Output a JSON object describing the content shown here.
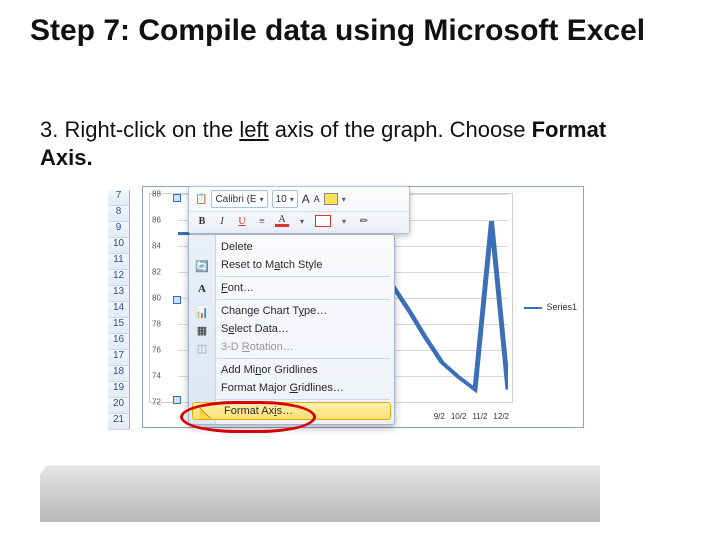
{
  "title": "Step 7: Compile data using Microsoft Excel",
  "instruction": {
    "prefix": "3. Right-click on the ",
    "underlined": "left",
    "middle": " axis of the graph. Choose ",
    "bold": "Format Axis."
  },
  "rows": [
    "7",
    "8",
    "9",
    "10",
    "11",
    "12",
    "13",
    "14",
    "15",
    "16",
    "17",
    "18",
    "19",
    "20",
    "21"
  ],
  "mini": {
    "font": "Calibri (E",
    "size": "10",
    "growLabel": "A",
    "shrinkLabel": "A",
    "b": "B",
    "i": "I",
    "u": "U",
    "a_color": "A"
  },
  "menu": {
    "delete": "Delete",
    "reset": {
      "pre": "Reset to M",
      "acc": "a",
      "post": "tch Style"
    },
    "font": {
      "acc": "F",
      "post": "ont…"
    },
    "changeType": {
      "pre": "Change Chart T",
      "acc": "y",
      "post": "pe…"
    },
    "selectData": {
      "pre": "S",
      "acc": "e",
      "post": "lect Data…"
    },
    "rotation": {
      "pre": "3-D ",
      "acc": "R",
      "post": "otation…"
    },
    "addMinor": {
      "pre": "Add Mi",
      "acc": "n",
      "post": "or Gridlines"
    },
    "formatMajor": {
      "pre": "Format Major ",
      "acc": "G",
      "post": "ridlines…"
    },
    "formatAxis": {
      "pre": "Format Ax",
      "acc": "i",
      "post": "s…"
    }
  },
  "legend": "Series1",
  "xticks": [
    "9/2",
    "10/2",
    "11/2",
    "12/2"
  ],
  "chart_data": {
    "type": "line",
    "title": "",
    "xlabel": "",
    "ylabel": "",
    "ylim": [
      72,
      88
    ],
    "y_ticks": [
      72,
      74,
      76,
      78,
      80,
      82,
      84,
      86,
      88
    ],
    "series": [
      {
        "name": "Series1",
        "values": [
          85,
          85,
          85.5,
          86,
          85,
          85,
          84.5,
          84.8,
          85,
          85.3,
          85,
          84,
          83,
          81,
          79,
          77,
          75,
          74,
          73,
          86,
          73
        ]
      }
    ],
    "x_categories_visible": [
      "9/2",
      "10/2",
      "11/2",
      "12/2"
    ]
  }
}
